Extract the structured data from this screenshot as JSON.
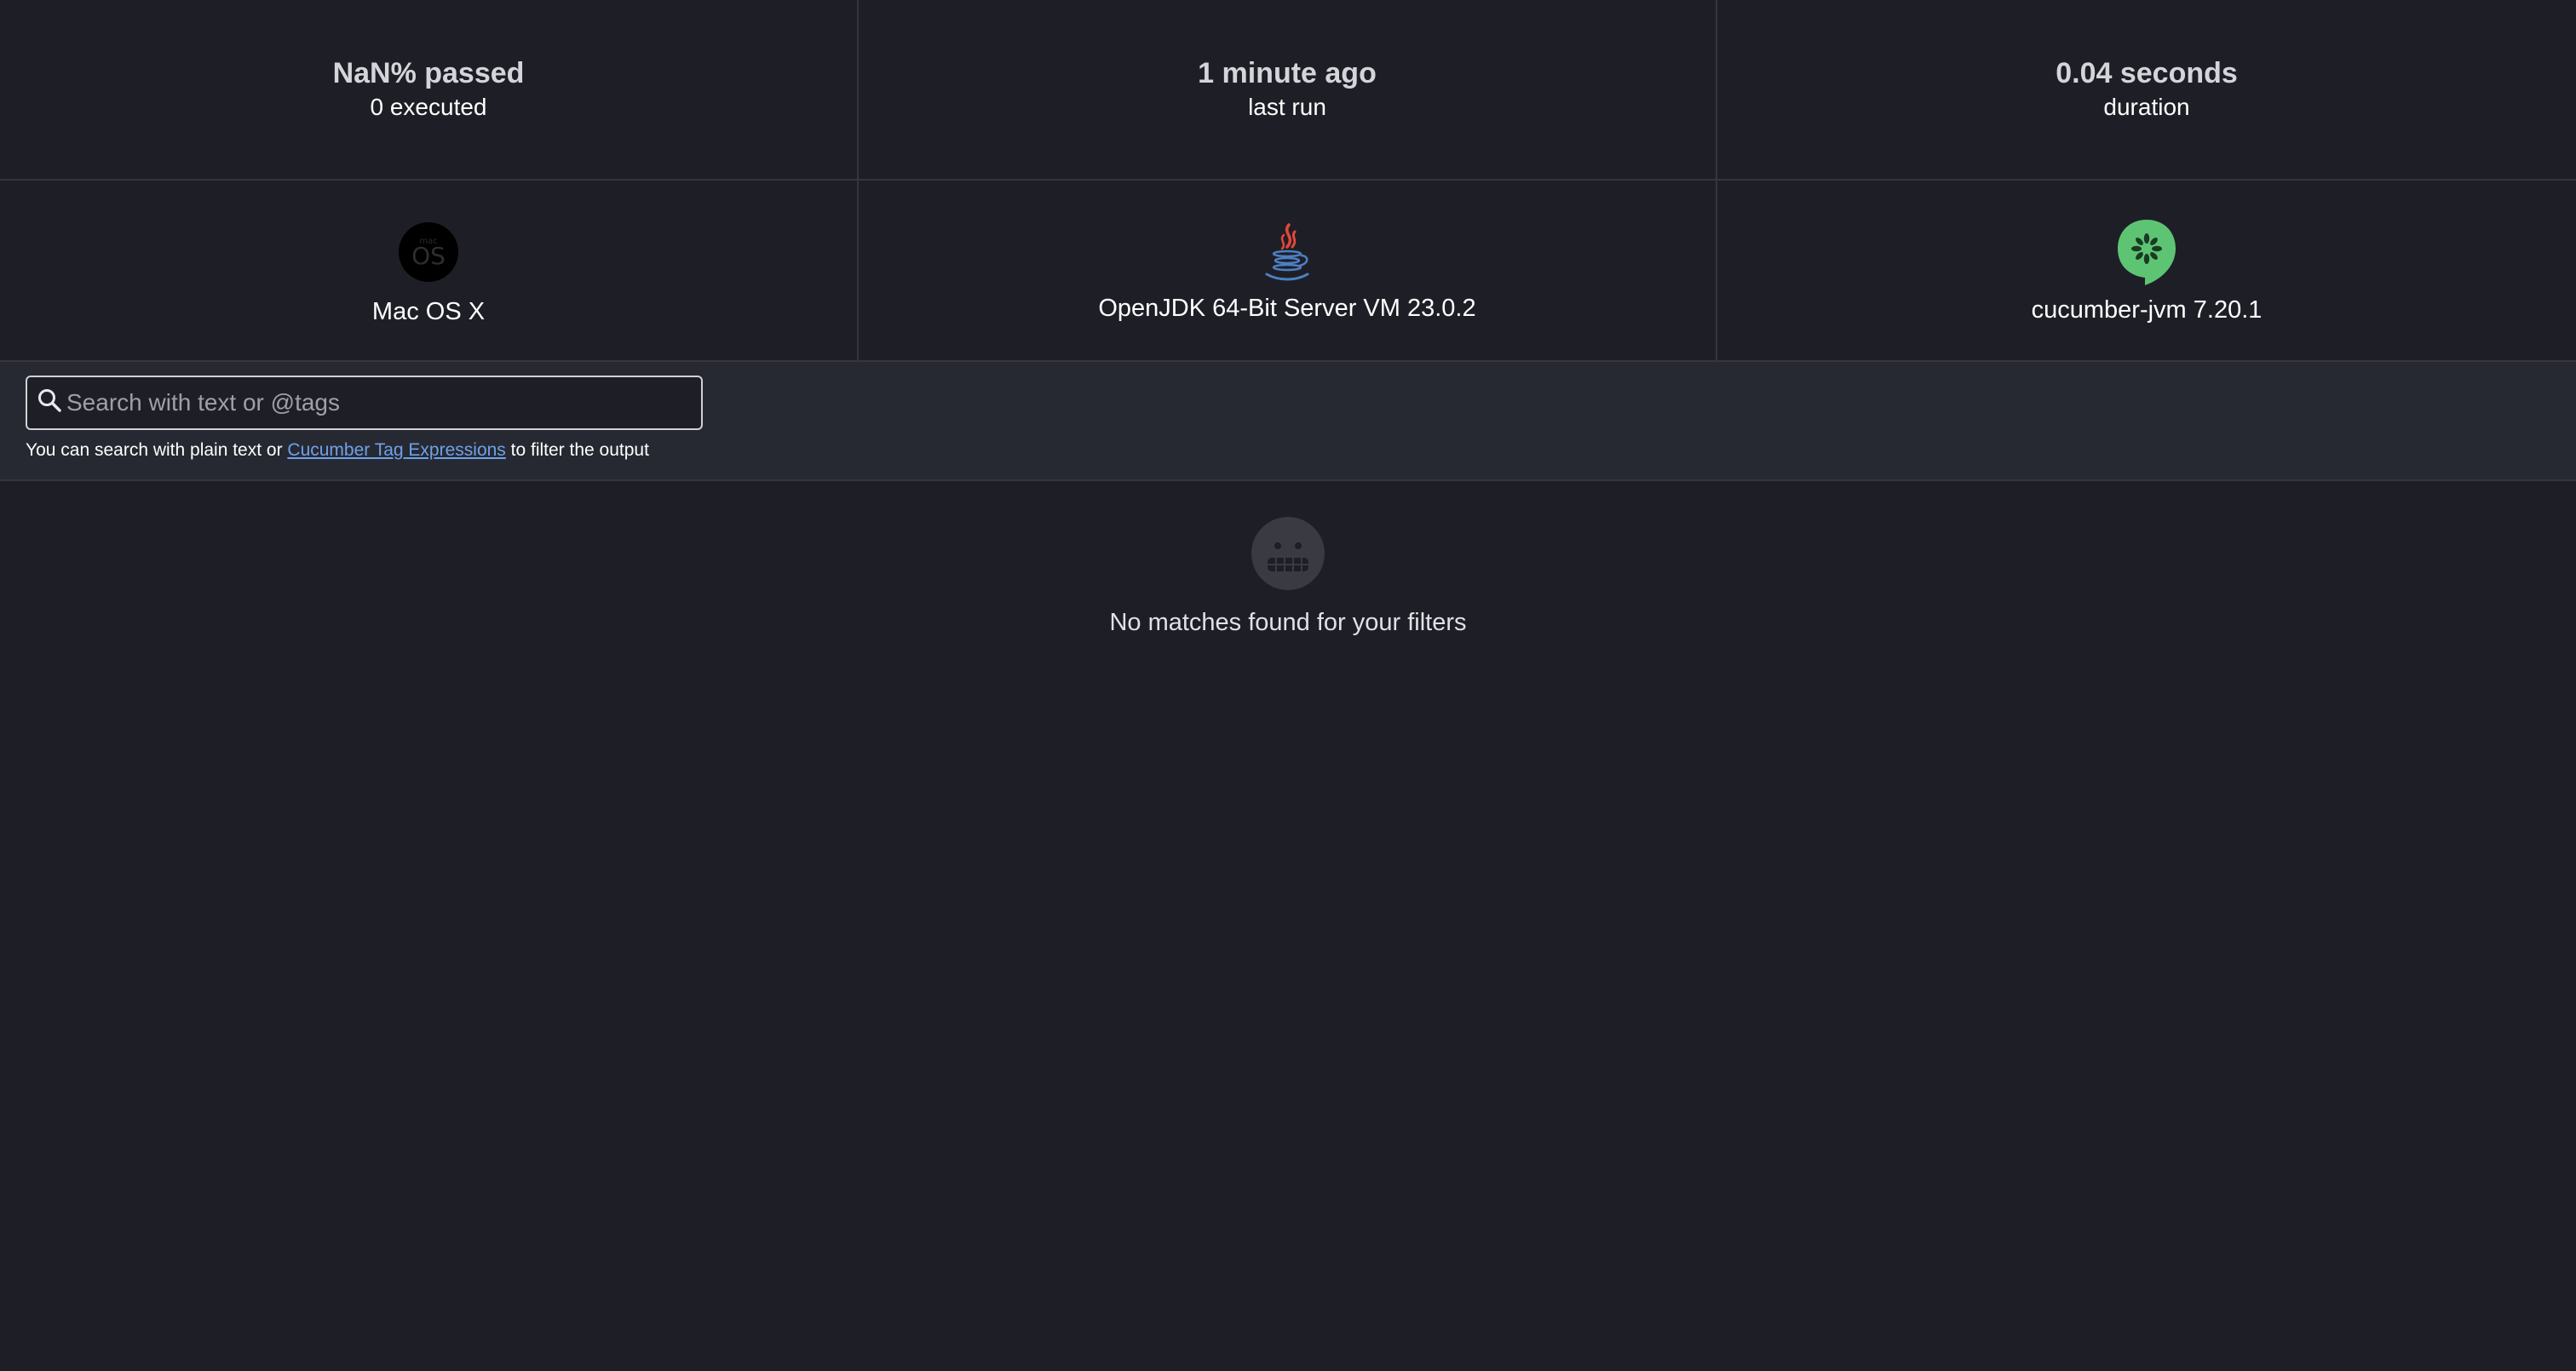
{
  "stats": {
    "pass_rate": "NaN% passed",
    "executed": "0 executed",
    "last_run_value": "1 minute ago",
    "last_run_label": "last run",
    "duration_value": "0.04 seconds",
    "duration_label": "duration"
  },
  "environment": {
    "os": "Mac OS X",
    "os_icon": "mac-os-icon",
    "runtime": "OpenJDK 64-Bit Server VM 23.0.2",
    "runtime_icon": "java-icon",
    "implementation": "cucumber-jvm 7.20.1",
    "implementation_icon": "cucumber-icon"
  },
  "search": {
    "placeholder": "Search with text or @tags",
    "value": "",
    "help_prefix": "You can search with plain text or ",
    "help_link": "Cucumber Tag Expressions",
    "help_suffix": " to filter the output"
  },
  "empty_state": {
    "message": "No matches found for your filters",
    "icon": "grimace-face-icon"
  },
  "colors": {
    "background": "#1e1f26",
    "search_bar_bg": "#272932",
    "border": "#35363d",
    "link": "#6ea2e8",
    "cucumber_green": "#5dc473"
  }
}
